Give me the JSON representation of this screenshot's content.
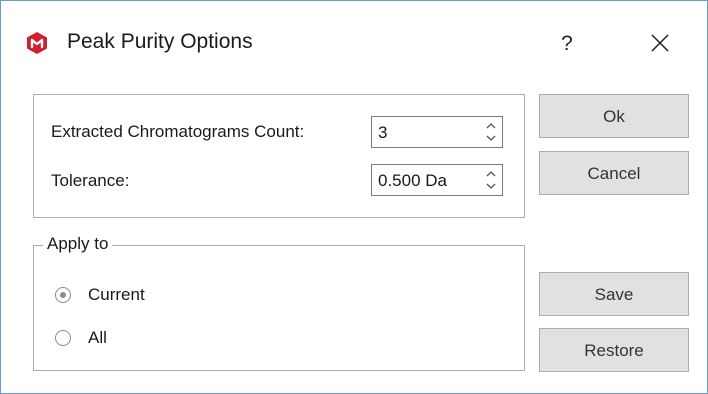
{
  "window": {
    "title": "Peak Purity Options",
    "help_label": "?",
    "close_label": "✕",
    "icon": "app-logo-icon",
    "icon_color": "#d0202e"
  },
  "params": {
    "count_label": "Extracted Chromatograms Count:",
    "count_value": "3",
    "tolerance_label": "Tolerance:",
    "tolerance_value": "0.500 Da"
  },
  "apply_to": {
    "legend": "Apply to",
    "options": [
      {
        "label": "Current",
        "checked": true
      },
      {
        "label": "All",
        "checked": false
      }
    ]
  },
  "buttons": {
    "ok": "Ok",
    "cancel": "Cancel",
    "save": "Save",
    "restore": "Restore"
  }
}
